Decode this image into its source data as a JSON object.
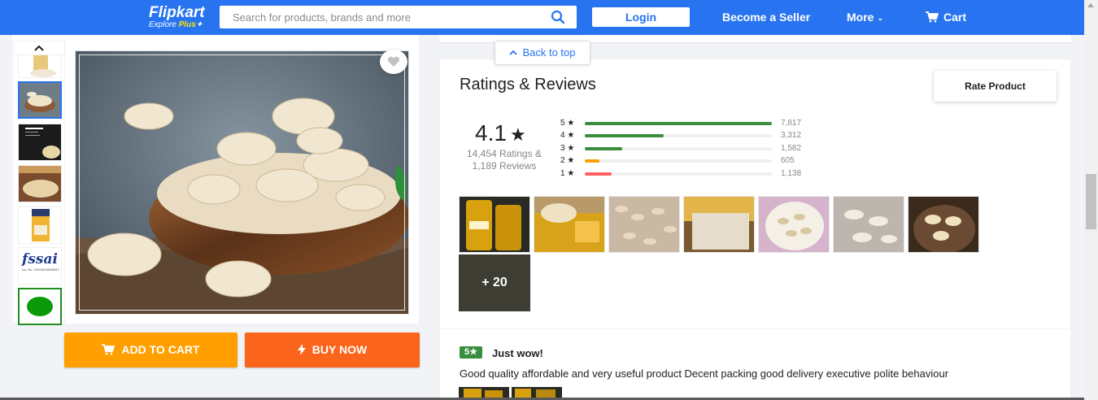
{
  "header": {
    "logo_main": "Flipkart",
    "logo_sub_text": "Explore",
    "logo_sub_plus": "Plus",
    "search_placeholder": "Search for products, brands and more",
    "login_label": "Login",
    "seller_label": "Become a Seller",
    "more_label": "More",
    "cart_label": "Cart"
  },
  "product": {
    "add_to_cart_label": "ADD TO CART",
    "buy_now_label": "BUY NOW",
    "thumbnails": [
      "cashew-pack",
      "cashew-bowl",
      "nutrition-label",
      "cashew-tray",
      "cashew-pouch",
      "fssai-logo",
      "veg-symbol"
    ],
    "fssai_text": "fssai",
    "fssai_license": "Lic. No. 10016011000647"
  },
  "reviews": {
    "back_to_top_label": "Back to top",
    "title": "Ratings & Reviews",
    "rate_button_label": "Rate Product",
    "average": "4.1",
    "average_star": "★",
    "ratings_count": "14,454 Ratings &",
    "reviews_count": "1,189 Reviews",
    "distribution": [
      {
        "label": "5 ★",
        "count": "7,817",
        "fraction": 1.0,
        "color": "#388e3c"
      },
      {
        "label": "4 ★",
        "count": "3,312",
        "fraction": 0.42,
        "color": "#388e3c"
      },
      {
        "label": "3 ★",
        "count": "1,582",
        "fraction": 0.2,
        "color": "#388e3c"
      },
      {
        "label": "2 ★",
        "count": "605",
        "fraction": 0.077,
        "color": "#ff9f00"
      },
      {
        "label": "1 ★",
        "count": "1,138",
        "fraction": 0.145,
        "color": "#ff6161"
      }
    ],
    "more_photos_label": "+ 20",
    "first_review": {
      "rating": "5★",
      "title": "Just wow!",
      "text": "Good quality affordable and very useful product Decent packing good delivery executive polite behaviour"
    }
  },
  "colors": {
    "brand_blue": "#2874f0",
    "cart_orange": "#ff9f00",
    "buy_orange": "#fb641b",
    "rating_green": "#388e3c"
  }
}
